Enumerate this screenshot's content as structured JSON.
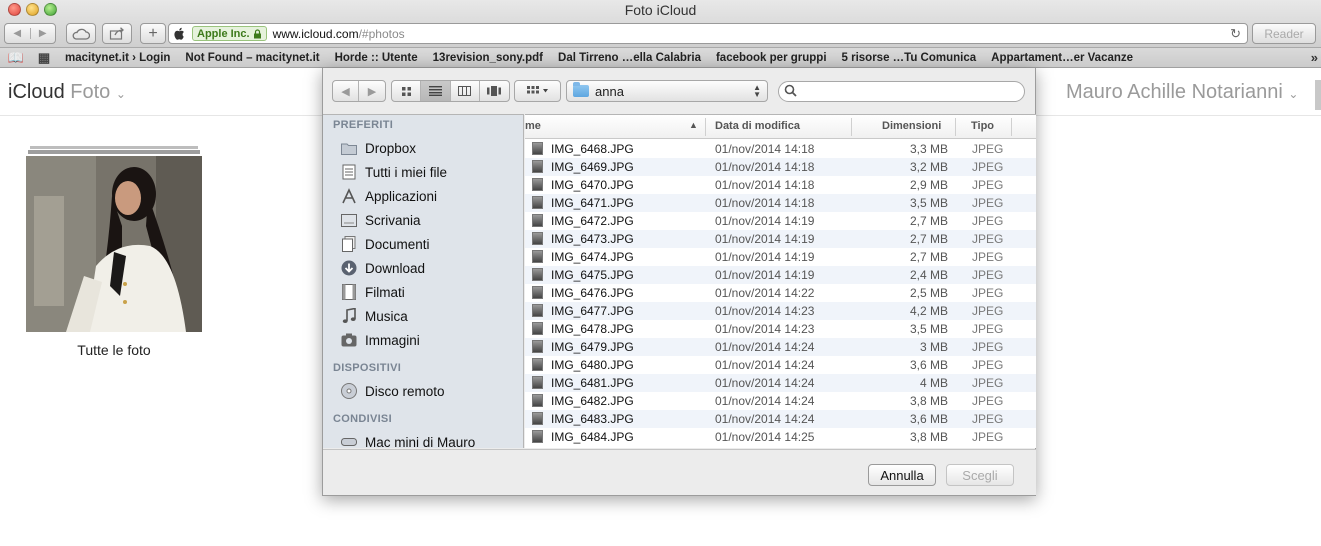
{
  "window": {
    "title": "Foto iCloud"
  },
  "toolbar": {
    "back_label": "◀",
    "forward_label": "▶",
    "new_tab_label": "+",
    "reader_label": "Reader"
  },
  "urlbar": {
    "ev_badge": "Apple Inc.",
    "host": "www.icloud.com",
    "path": "/#photos"
  },
  "bookmarks": [
    "macitynet.it › Login",
    "Not Found – macitynet.it",
    "Horde :: Utente",
    "13revision_sony.pdf",
    "Dal Tirreno …ella Calabria",
    "facebook per gruppi",
    "5 risorse …Tu Comunica",
    "Appartament…er Vacanze"
  ],
  "icloud": {
    "brand": "iCloud",
    "app": "Foto",
    "user": "Mauro Achille Notarianni",
    "album_caption": "Tutte le foto"
  },
  "dialog": {
    "folder": "anna",
    "sidebar": {
      "favorites_heading": "PREFERITI",
      "favorites": [
        {
          "label": "Dropbox",
          "icon": "folder-icon"
        },
        {
          "label": "Tutti i miei file",
          "icon": "all-files-icon"
        },
        {
          "label": "Applicazioni",
          "icon": "applications-icon"
        },
        {
          "label": "Scrivania",
          "icon": "desktop-icon"
        },
        {
          "label": "Documenti",
          "icon": "documents-icon"
        },
        {
          "label": "Download",
          "icon": "download-icon"
        },
        {
          "label": "Filmati",
          "icon": "movies-icon"
        },
        {
          "label": "Musica",
          "icon": "music-icon"
        },
        {
          "label": "Immagini",
          "icon": "pictures-icon"
        }
      ],
      "devices_heading": "DISPOSITIVI",
      "devices": [
        {
          "label": "Disco remoto",
          "icon": "remote-disc-icon"
        }
      ],
      "shared_heading": "CONDIVISI",
      "shared": [
        {
          "label": "Mac mini di Mauro",
          "icon": "computer-icon"
        }
      ]
    },
    "columns": {
      "name": "me",
      "date": "Data di modifica",
      "size": "Dimensioni",
      "kind": "Tipo"
    },
    "files": [
      {
        "name": "IMG_6468.JPG",
        "date": "01/nov/2014 14:18",
        "size": "3,3 MB",
        "kind": "JPEG"
      },
      {
        "name": "IMG_6469.JPG",
        "date": "01/nov/2014 14:18",
        "size": "3,2 MB",
        "kind": "JPEG"
      },
      {
        "name": "IMG_6470.JPG",
        "date": "01/nov/2014 14:18",
        "size": "2,9 MB",
        "kind": "JPEG"
      },
      {
        "name": "IMG_6471.JPG",
        "date": "01/nov/2014 14:18",
        "size": "3,5 MB",
        "kind": "JPEG"
      },
      {
        "name": "IMG_6472.JPG",
        "date": "01/nov/2014 14:19",
        "size": "2,7 MB",
        "kind": "JPEG"
      },
      {
        "name": "IMG_6473.JPG",
        "date": "01/nov/2014 14:19",
        "size": "2,7 MB",
        "kind": "JPEG"
      },
      {
        "name": "IMG_6474.JPG",
        "date": "01/nov/2014 14:19",
        "size": "2,7 MB",
        "kind": "JPEG"
      },
      {
        "name": "IMG_6475.JPG",
        "date": "01/nov/2014 14:19",
        "size": "2,4 MB",
        "kind": "JPEG"
      },
      {
        "name": "IMG_6476.JPG",
        "date": "01/nov/2014 14:22",
        "size": "2,5 MB",
        "kind": "JPEG"
      },
      {
        "name": "IMG_6477.JPG",
        "date": "01/nov/2014 14:23",
        "size": "4,2 MB",
        "kind": "JPEG"
      },
      {
        "name": "IMG_6478.JPG",
        "date": "01/nov/2014 14:23",
        "size": "3,5 MB",
        "kind": "JPEG"
      },
      {
        "name": "IMG_6479.JPG",
        "date": "01/nov/2014 14:24",
        "size": "3 MB",
        "kind": "JPEG"
      },
      {
        "name": "IMG_6480.JPG",
        "date": "01/nov/2014 14:24",
        "size": "3,6 MB",
        "kind": "JPEG"
      },
      {
        "name": "IMG_6481.JPG",
        "date": "01/nov/2014 14:24",
        "size": "4 MB",
        "kind": "JPEG"
      },
      {
        "name": "IMG_6482.JPG",
        "date": "01/nov/2014 14:24",
        "size": "3,8 MB",
        "kind": "JPEG"
      },
      {
        "name": "IMG_6483.JPG",
        "date": "01/nov/2014 14:24",
        "size": "3,6 MB",
        "kind": "JPEG"
      },
      {
        "name": "IMG_6484.JPG",
        "date": "01/nov/2014 14:25",
        "size": "3,8 MB",
        "kind": "JPEG"
      }
    ],
    "cancel_label": "Annulla",
    "choose_label": "Scegli"
  }
}
